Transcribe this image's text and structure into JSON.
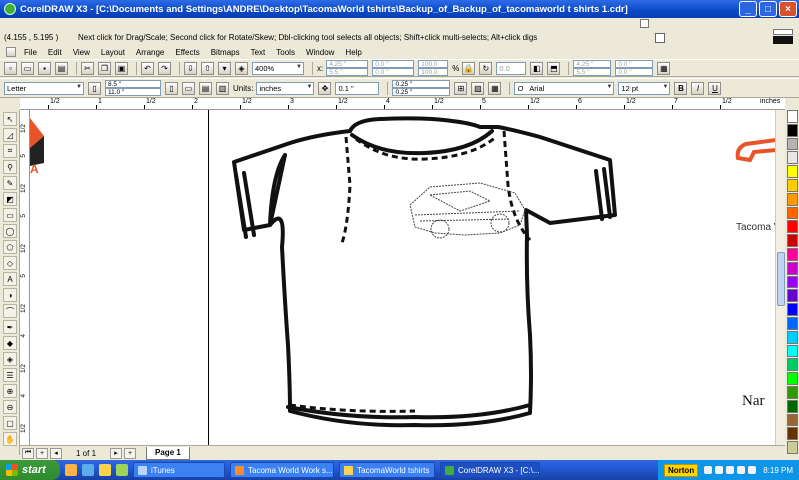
{
  "window": {
    "title": "CorelDRAW X3 - [C:\\Documents and Settings\\ANDRE\\Desktop\\TacomaWorld tshirts\\Backup_of_Backup_of_tacomaworld t shirts 1.cdr]",
    "minimize": "_",
    "maximize": "□",
    "close": "×"
  },
  "status": {
    "coords": "(4.155 , 5.195 )",
    "hint": "Next click for Drag/Scale; Second click for Rotate/Skew; Dbl-clicking tool selects all objects; Shift+click multi-selects; Alt+click digs"
  },
  "menu": [
    "File",
    "Edit",
    "View",
    "Layout",
    "Arrange",
    "Effects",
    "Bitmaps",
    "Text",
    "Tools",
    "Window",
    "Help"
  ],
  "toolbar1": {
    "zoom": "400%",
    "pos_x": "4.25 \"",
    "pos_y": "5.5 \"",
    "size_w": "0.0 \"",
    "size_h": "0.0 \"",
    "scale_w": "100.0",
    "scale_h": "100.0",
    "pct": "%",
    "rotation": "0.0",
    "pos2_x": "4.25 \"",
    "pos2_y": "5.5 \"",
    "size2_w": "0.0 \"",
    "size2_h": "0.0 \""
  },
  "toolbar2": {
    "paper": "Letter",
    "width": "8.5 \"",
    "height": "11.0 \"",
    "units_label": "Units:",
    "units": "inches",
    "nudge": "0.1 \"",
    "dup_x": "0.25 \"",
    "dup_y": "0.25 \"",
    "font": "Arial",
    "font_size": "12 pt"
  },
  "ruler": {
    "h_ticks": [
      "1/2",
      "1",
      "1/2",
      "2",
      "1/2",
      "3",
      "1/2",
      "4",
      "1/2",
      "5",
      "1/2",
      "6",
      "1/2",
      "7",
      "1/2"
    ],
    "h_unit": "inches",
    "v_ticks": [
      "1/2",
      "5",
      "1/2",
      "5",
      "1/2",
      "5",
      "1/2",
      "4",
      "1/2",
      "4",
      "1/2"
    ]
  },
  "canvas": {
    "text_tacoma": "Tacoma V",
    "text_nar": "Nar",
    "text_logo": "A"
  },
  "pagebar": {
    "add": "+",
    "count": "1 of 1",
    "tab": "Page 1"
  },
  "taskbar": {
    "start": "start",
    "tasks": [
      "iTunes",
      "Tacoma World Work s...",
      "TacomaWorld tshirts",
      "CorelDRAW X3 - [C:\\..."
    ],
    "norton": "Norton",
    "clock": "8:19 PM"
  },
  "palette": [
    "#ffffff",
    "#000000",
    "#b3b3b3",
    "#e6e6e6",
    "#ffff00",
    "#ffcc00",
    "#ff9900",
    "#ff6600",
    "#ff0000",
    "#cc0000",
    "#ff0099",
    "#cc00cc",
    "#9900ff",
    "#6600cc",
    "#0000ff",
    "#0066ff",
    "#00ccff",
    "#00ffff",
    "#00cc66",
    "#00ff00",
    "#339900",
    "#006600",
    "#996633",
    "#663300",
    "#cccc99"
  ],
  "colors": {
    "accent_orange": "#e8542a",
    "logo_dark": "#222222"
  }
}
